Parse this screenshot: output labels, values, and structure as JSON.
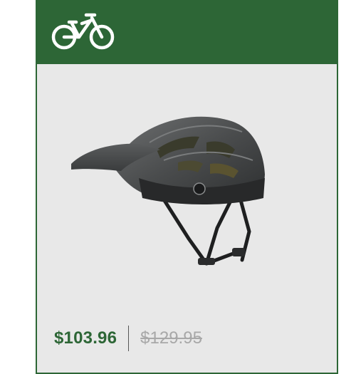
{
  "header": {
    "icon": "bicycle-icon",
    "background_color": "#2d6636"
  },
  "product": {
    "image": "helmet-image",
    "sale_price": "$103.96",
    "original_price": "$129.95",
    "sale_price_color": "#2d6636",
    "original_price_color": "#a8a8a8"
  }
}
